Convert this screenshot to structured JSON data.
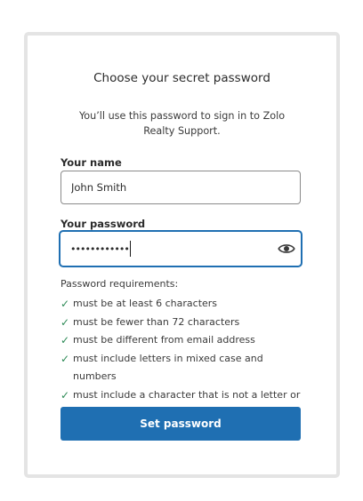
{
  "form": {
    "title": "Choose your secret password",
    "subtitle": "You’ll use this password to sign in to Zolo Realty Support.",
    "name_label": "Your name",
    "name_value": "John Smith",
    "password_label": "Your password",
    "password_value": "••••••••••••",
    "show_password_icon": "eye-icon",
    "requirements_title": "Password requirements:",
    "requirements": [
      {
        "text": "must be at least 6 characters",
        "met": true
      },
      {
        "text": "must be fewer than 72 characters",
        "met": true
      },
      {
        "text": "must be different from email address",
        "met": true
      },
      {
        "text": "must include letters in mixed case and numbers",
        "met": true
      },
      {
        "text": "must include a character that is not a letter or number",
        "met": true
      }
    ],
    "check_glyph": "✓",
    "submit_label": "Set password"
  },
  "colors": {
    "accent": "#1f6fb2",
    "check": "#2e8b57",
    "card_border": "#e4e4e4"
  }
}
